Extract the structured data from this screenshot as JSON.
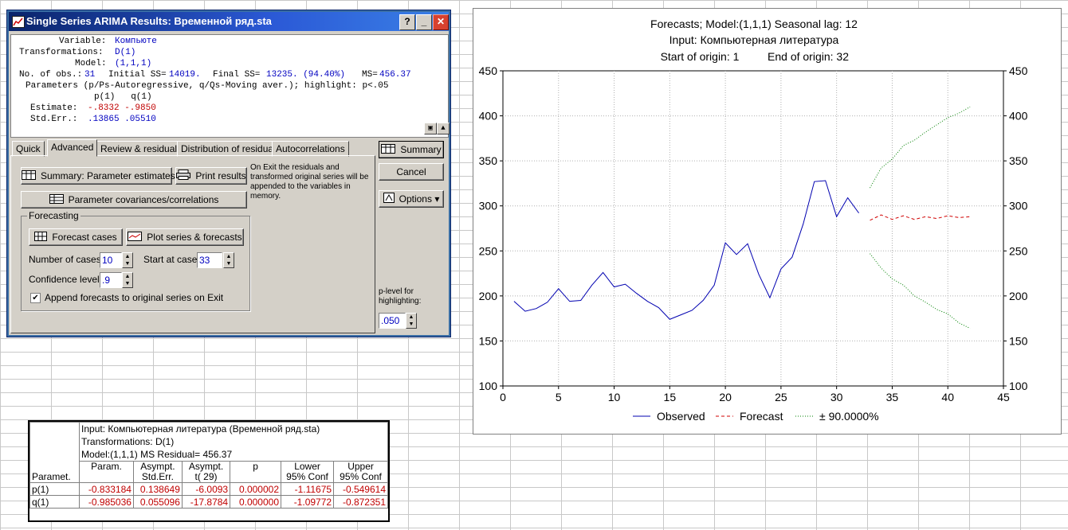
{
  "window": {
    "title": "Single Series ARIMA Results: Временной ряд.sta",
    "help_label": "?",
    "min_label": "_",
    "close_label": "✕",
    "info": {
      "variable_label": "Variable:",
      "variable_value": "Компьюте",
      "transformations_label": "Transformations:",
      "transformations_value": "D(1)",
      "model_label": "Model:",
      "model_value": "(1,1,1)",
      "obs_label": "No. of obs.:",
      "obs_value": "31",
      "initial_ss_label": "Initial SS=",
      "initial_ss_value": "14019.",
      "final_ss_label": "Final SS=",
      "final_ss_value": "13235. (94.40%)",
      "ms_label": "MS=",
      "ms_value": "456.37",
      "params_line": "Parameters (p/Ps-Autoregressive, q/Qs-Moving aver.); highlight: p<.05",
      "param_headers": "p(1)   q(1)",
      "estimate_label": "Estimate:",
      "estimate_value": "-.8332 -.9850",
      "stderr_label": "Std.Err.:",
      "stderr_value": ".13865 .05510"
    },
    "tabs": [
      "Quick",
      "Advanced",
      "Review & residuals",
      "Distribution of residuals",
      "Autocorrelations"
    ],
    "active_tab": "Advanced",
    "advanced": {
      "summary_param_label": "Summary:  Parameter estimates",
      "print_results_label": "Print results",
      "exit_note": "On Exit the residuals and transformed original series will be appended to the variables in memory.",
      "param_cov_label": "Parameter covariances/correlations",
      "forecasting_group": "Forecasting",
      "forecast_cases_label": "Forecast cases",
      "plot_series_label": "Plot series & forecasts",
      "num_cases_label": "Number of cases:",
      "num_cases_value": "10",
      "start_case_label": "Start at case:",
      "start_case_value": "33",
      "confidence_label": "Confidence level:",
      "confidence_value": ".9",
      "append_label": "Append forecasts to original series on Exit",
      "append_checked": true
    },
    "side": {
      "summary_label": "Summary",
      "cancel_label": "Cancel",
      "options_label": "Options",
      "plevel_label": "p-level for highlighting:",
      "plevel_value": ".050"
    }
  },
  "chart_data": {
    "type": "line",
    "title": "Forecasts; Model:(1,1,1) Seasonal lag: 12",
    "subtitle1": "Input: Компьютерная литература",
    "subtitle2_a": "Start of origin: 1",
    "subtitle2_b": "End of origin: 32",
    "xlim": [
      0,
      45
    ],
    "ylim": [
      100,
      450
    ],
    "xticks": [
      "0",
      "5",
      "10",
      "15",
      "20",
      "25",
      "30",
      "35",
      "40",
      "45"
    ],
    "yticks": [
      "100",
      "150",
      "200",
      "250",
      "300",
      "350",
      "400",
      "450"
    ],
    "grid": true,
    "legend_position": "bottom",
    "series": [
      {
        "name": "Observed",
        "color": "#0000b0",
        "style": "solid",
        "x": [
          1,
          2,
          3,
          4,
          5,
          6,
          7,
          8,
          9,
          10,
          11,
          12,
          13,
          14,
          15,
          16,
          17,
          18,
          19,
          20,
          21,
          22,
          23,
          24,
          25,
          26,
          27,
          28,
          29,
          30,
          31,
          32
        ],
        "y": [
          194,
          183,
          186,
          193,
          208,
          194,
          195,
          212,
          226,
          210,
          213,
          203,
          194,
          187,
          174,
          179,
          184,
          195,
          212,
          259,
          246,
          258,
          224,
          198,
          230,
          243,
          280,
          327,
          328,
          288,
          309,
          292
        ]
      },
      {
        "name": "Forecast",
        "color": "#d00000",
        "style": "dashed",
        "x": [
          33,
          34,
          35,
          36,
          37,
          38,
          39,
          40,
          41,
          42
        ],
        "y": [
          284,
          290,
          285,
          289,
          285,
          288,
          286,
          289,
          287,
          288
        ]
      },
      {
        "name": "± 90.0000%",
        "color": "#008000",
        "style": "dotted",
        "x": [
          33,
          34,
          35,
          36,
          37,
          38,
          39,
          40,
          41,
          42
        ],
        "y": [
          320,
          342,
          352,
          367,
          373,
          382,
          390,
          398,
          403,
          410
        ]
      },
      {
        "name": "",
        "color": "#008000",
        "style": "dotted",
        "x": [
          33,
          34,
          35,
          36,
          37,
          38,
          39,
          40,
          41,
          42
        ],
        "y": [
          247,
          231,
          219,
          212,
          200,
          193,
          185,
          180,
          170,
          164
        ]
      }
    ]
  },
  "results_table": {
    "info_line1": "Input: Компьютерная литература (Временной ряд.sta)",
    "info_line2": "Transformations: D(1)",
    "info_line3": "Model:(1,1,1) MS Residual= 456.37",
    "row_header": "Paramet.",
    "columns": [
      [
        "Param.",
        ""
      ],
      [
        "Asympt.",
        "Std.Err."
      ],
      [
        "Asympt.",
        "t(   29)"
      ],
      [
        "p",
        ""
      ],
      [
        "Lower",
        "95% Conf"
      ],
      [
        "Upper",
        "95% Conf"
      ]
    ],
    "rows": [
      {
        "name": "p(1)",
        "values": [
          "-0.833184",
          "0.138649",
          "-6.0093",
          "0.000002",
          "-1.11675",
          "-0.549614"
        ]
      },
      {
        "name": "q(1)",
        "values": [
          "-0.985036",
          "0.055096",
          "-17.8784",
          "0.000000",
          "-1.09772",
          "-0.872351"
        ]
      }
    ]
  }
}
